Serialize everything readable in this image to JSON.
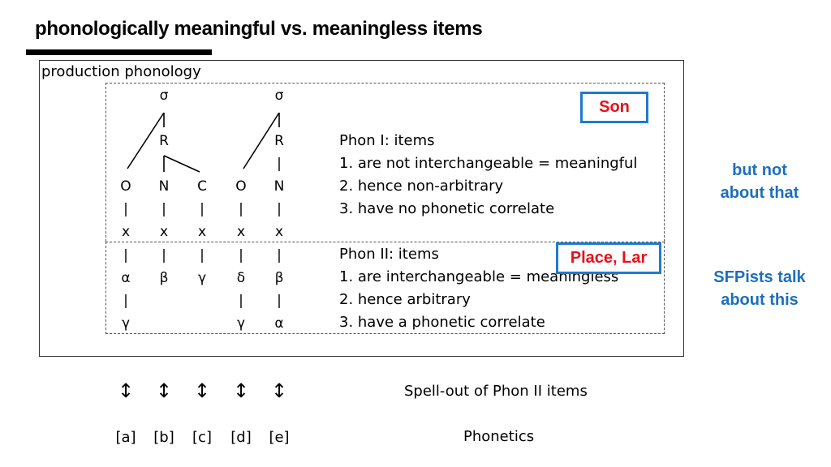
{
  "title": "phonologically meaningful vs. meaningless items",
  "box_label": "production phonology",
  "tree": {
    "syllables": [
      {
        "sigma": "σ",
        "rhyme": "R"
      },
      {
        "sigma": "σ",
        "rhyme": "R"
      }
    ],
    "columns": [
      {
        "constituent": "O",
        "slot": "x",
        "phon2": "α",
        "phon2_dep": "γ"
      },
      {
        "constituent": "N",
        "slot": "x",
        "phon2": "β",
        "phon2_dep": ""
      },
      {
        "constituent": "C",
        "slot": "x",
        "phon2": "γ",
        "phon2_dep": ""
      },
      {
        "constituent": "O",
        "slot": "x",
        "phon2": "δ",
        "phon2_dep": "γ"
      },
      {
        "constituent": "N",
        "slot": "x",
        "phon2": "β",
        "phon2_dep": "α"
      }
    ]
  },
  "phon1": {
    "heading": "Phon I: items",
    "items": [
      "1. are not interchangeable = meaningful",
      "2. hence non-arbitrary",
      "3. have no phonetic correlate"
    ],
    "tag": "Son"
  },
  "phon2": {
    "heading": "Phon II: items",
    "items": [
      "1. are interchangeable = meaningless",
      "2. hence arbitrary",
      "3. have a phonetic correlate"
    ],
    "tag": "Place, Lar"
  },
  "side_notes": {
    "top": [
      "but not",
      "about that"
    ],
    "bottom": [
      "SFPists talk",
      "about this"
    ]
  },
  "spellout": {
    "arrow_icon": "up-down-arrow-icon",
    "label": "Spell-out of Phon II items"
  },
  "phonetics": {
    "items": [
      "[a]",
      "[b]",
      "[c]",
      "[d]",
      "[e]"
    ],
    "label": "Phonetics"
  },
  "colors": {
    "tag_border": "#1f7ad1",
    "tag_text": "#e8101a",
    "side_note": "#1c6fbe"
  }
}
